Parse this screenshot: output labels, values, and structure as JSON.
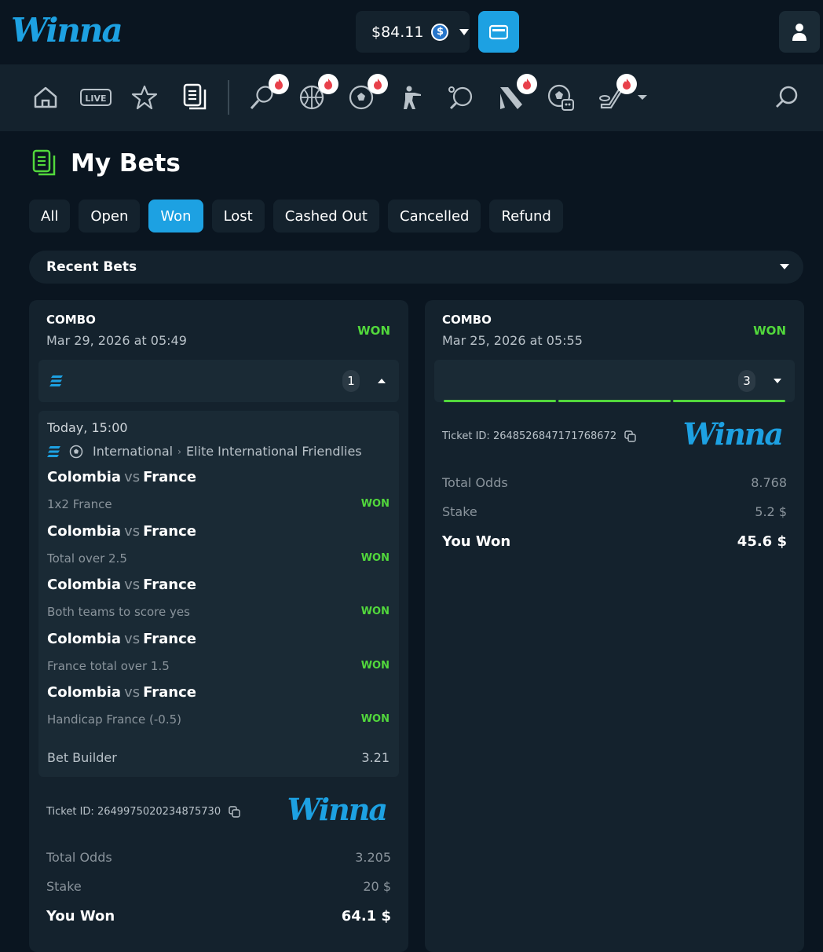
{
  "header": {
    "logo": "Winna",
    "balance": "$84.11"
  },
  "page": {
    "title": "My Bets"
  },
  "filters": [
    "All",
    "Open",
    "Won",
    "Lost",
    "Cashed Out",
    "Cancelled",
    "Refund"
  ],
  "active_filter": "Won",
  "recent": {
    "label": "Recent Bets"
  },
  "bets": [
    {
      "type": "COMBO",
      "date": "Mar 29, 2026 at 05:49",
      "status": "WON",
      "count": "1",
      "when": "Today, 15:00",
      "league_country": "International",
      "league_name": "Elite International Friendlies",
      "legs": [
        {
          "home": "Colombia",
          "vs": "vs",
          "away": "France",
          "market": "1x2 France",
          "status": "WON"
        },
        {
          "home": "Colombia",
          "vs": "vs",
          "away": "France",
          "market": "Total over 2.5",
          "status": "WON"
        },
        {
          "home": "Colombia",
          "vs": "vs",
          "away": "France",
          "market": "Both teams to score yes",
          "status": "WON"
        },
        {
          "home": "Colombia",
          "vs": "vs",
          "away": "France",
          "market": "France total over 1.5",
          "status": "WON"
        },
        {
          "home": "Colombia",
          "vs": "vs",
          "away": "France",
          "market": "Handicap France (-0.5)",
          "status": "WON"
        }
      ],
      "bet_builder_label": "Bet Builder",
      "bet_builder_odds": "3.21",
      "ticket": "Ticket ID: 2649975020234875730",
      "logo": "Winna",
      "total_odds_label": "Total Odds",
      "total_odds": "3.205",
      "stake_label": "Stake",
      "stake": "20 $",
      "won_label": "You Won",
      "won": "64.1 $"
    },
    {
      "type": "COMBO",
      "date": "Mar 25, 2026 at 05:55",
      "status": "WON",
      "count": "3",
      "ticket": "Ticket ID: 2648526847171768672",
      "logo": "Winna",
      "total_odds_label": "Total Odds",
      "total_odds": "8.768",
      "stake_label": "Stake",
      "stake": "5.2 $",
      "won_label": "You Won",
      "won": "45.6 $"
    }
  ],
  "colors": {
    "accent": "#1da1e2",
    "won": "#52d83c",
    "fire": "#e8404a"
  }
}
